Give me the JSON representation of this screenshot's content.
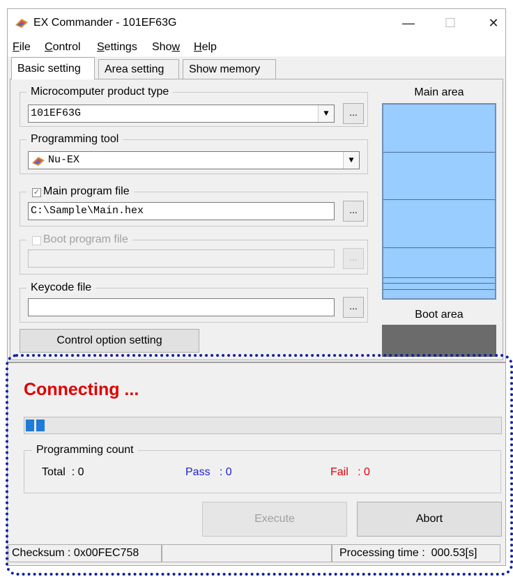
{
  "window": {
    "title": "EX Commander - 101EF63G",
    "minimize": "—",
    "maximize": "☐",
    "close": "✕"
  },
  "menu": [
    {
      "label": "File"
    },
    {
      "label": "Control"
    },
    {
      "label": "Settings"
    },
    {
      "label": "Show"
    },
    {
      "label": "Help"
    }
  ],
  "tabs": [
    {
      "label": "Basic setting",
      "active": true
    },
    {
      "label": "Area setting",
      "active": false
    },
    {
      "label": "Show memory",
      "active": false
    }
  ],
  "basic": {
    "product_type": {
      "label": "Microcomputer product type",
      "value": "101EF63G"
    },
    "programming_tool": {
      "label": "Programming tool",
      "value": "Nu-EX"
    },
    "main_program": {
      "label": "Main program file",
      "checked": true,
      "value": "C:\\Sample\\Main.hex"
    },
    "boot_program": {
      "label": "Boot program file",
      "checked": false,
      "enabled": false,
      "value": ""
    },
    "keycode": {
      "label": "Keycode file",
      "value": ""
    },
    "control_option_button": "Control option setting",
    "browse_label": "..."
  },
  "memory_map": {
    "main_label": "Main area",
    "boot_label": "Boot area",
    "main_color": "#99ccff",
    "boot_color": "#6b6b6b"
  },
  "status": {
    "message": "Connecting ...",
    "message_color": "#e00000",
    "progress": 0.05,
    "progress_color": "#1e7bd8"
  },
  "count": {
    "label": "Programming count",
    "total": "Total  : 0",
    "pass": "Pass   : 0",
    "fail": "Fail   : 0",
    "pass_color": "#2020d0",
    "fail_color": "#e00000"
  },
  "buttons": {
    "execute": "Execute",
    "abort": "Abort"
  },
  "statusbar": {
    "checksum": "Checksum : 0x00FEC758",
    "processing_time": "Processing time :  000.53[s]"
  }
}
